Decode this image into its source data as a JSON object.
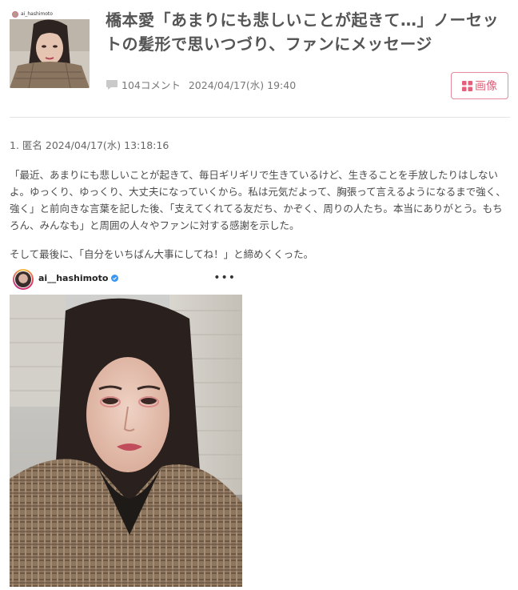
{
  "article": {
    "title": "橋本愛「あまりにも悲しいことが起きて…」ノーセットの髪形で思いつづり、ファンにメッセージ",
    "comment_count": "104コメント",
    "datetime": "2024/04/17(水) 19:40",
    "image_button_label": "画像",
    "thumbnail_username": "ai_hashimoto"
  },
  "comment": {
    "header": "1. 匿名 2024/04/17(水) 13:18:16",
    "paragraph1": "「最近、あまりにも悲しいことが起きて、毎日ギリギリで生きているけど、生きることを手放したりはしないよ。ゆっくり、ゆっくり、大丈夫になっていくから。私は元気だよって、胸張って言えるようになるまで強く、強く」と前向きな言葉を記した後、「支えてくれてる友だち、かぞく、周りの人たち。本当にありがとう。もちろん、みんなも」と周囲の人々やファンに対する感謝を示した。",
    "paragraph2": "そして最後に、「自分をいちばん大事にしてね！」と締めくくった。"
  },
  "embed": {
    "username": "ai__hashimoto",
    "more_label": "•••"
  },
  "colors": {
    "accent": "#e4607a",
    "title": "#555555",
    "divider": "#e4e4e4",
    "verified": "#3897f0"
  }
}
